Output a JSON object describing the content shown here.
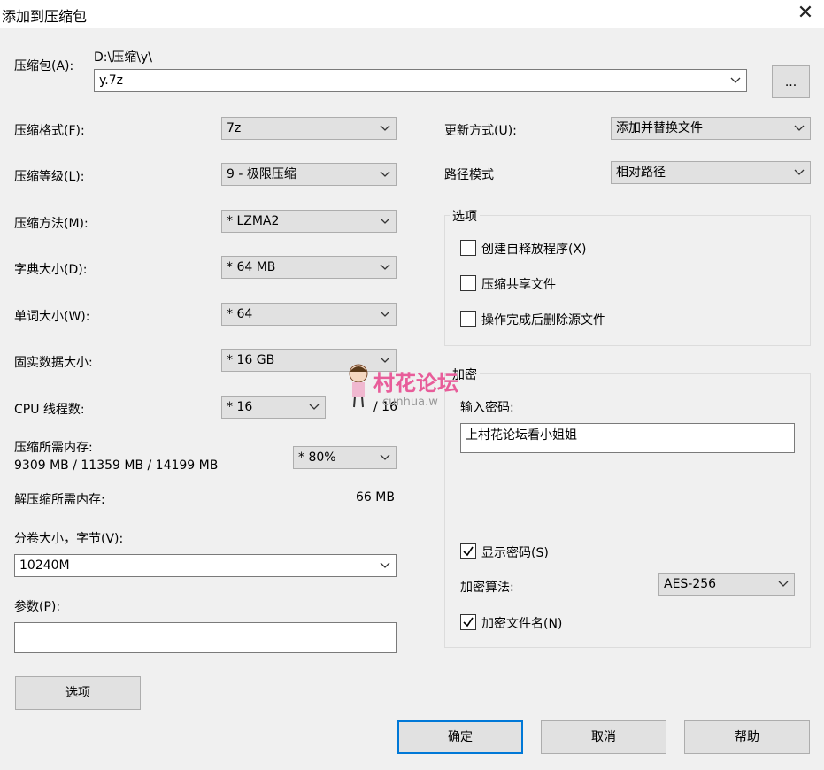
{
  "window": {
    "title": "添加到压缩包",
    "close_glyph": "✕"
  },
  "archive": {
    "label": "压缩包(A):",
    "path": "D:\\压缩\\y\\",
    "name": "y.7z",
    "browse": "..."
  },
  "left": {
    "format": {
      "label": "压缩格式(F):",
      "value": "7z"
    },
    "level": {
      "label": "压缩等级(L):",
      "value": "9 - 极限压缩"
    },
    "method": {
      "label": "压缩方法(M):",
      "value": "*  LZMA2"
    },
    "dict": {
      "label": "字典大小(D):",
      "value": "*  64 MB"
    },
    "word": {
      "label": "单词大小(W):",
      "value": "*  64"
    },
    "solid": {
      "label": "固实数据大小:",
      "value": "*  16 GB"
    },
    "threads": {
      "label": "CPU 线程数:",
      "value": "*  16",
      "max": "/ 16"
    },
    "mem": {
      "label": "压缩所需内存:",
      "detail": "9309 MB / 11359 MB / 14199 MB",
      "value": "*  80%"
    },
    "decomp": {
      "label": "解压缩所需内存:",
      "value": "66 MB"
    },
    "volume": {
      "label": "分卷大小，字节(V):",
      "value": "10240M"
    },
    "params": {
      "label": "参数(P):",
      "value": ""
    },
    "options_button": "选项"
  },
  "right": {
    "update": {
      "label": "更新方式(U):",
      "value": "添加并替换文件"
    },
    "pathmode": {
      "label": "路径模式",
      "value": "相对路径"
    },
    "options": {
      "title": "选项",
      "items": [
        {
          "label": "创建自释放程序(X)",
          "checked": false
        },
        {
          "label": "压缩共享文件",
          "checked": false
        },
        {
          "label": "操作完成后删除源文件",
          "checked": false
        }
      ]
    },
    "encryption": {
      "title": "加密",
      "password_label": "输入密码:",
      "password_value": "上村花论坛看小姐姐",
      "show_password": {
        "label": "显示密码(S)",
        "checked": true
      },
      "algo_label": "加密算法:",
      "algo_value": "AES-256",
      "encrypt_names": {
        "label": "加密文件名(N)",
        "checked": true
      }
    }
  },
  "watermark": {
    "text": "村花论坛",
    "sub": "cunhua.w"
  },
  "footer": {
    "ok": "确定",
    "cancel": "取消",
    "help": "帮助"
  },
  "colors": {
    "accent": "#0078d7",
    "watermark": "#e85d9a"
  }
}
